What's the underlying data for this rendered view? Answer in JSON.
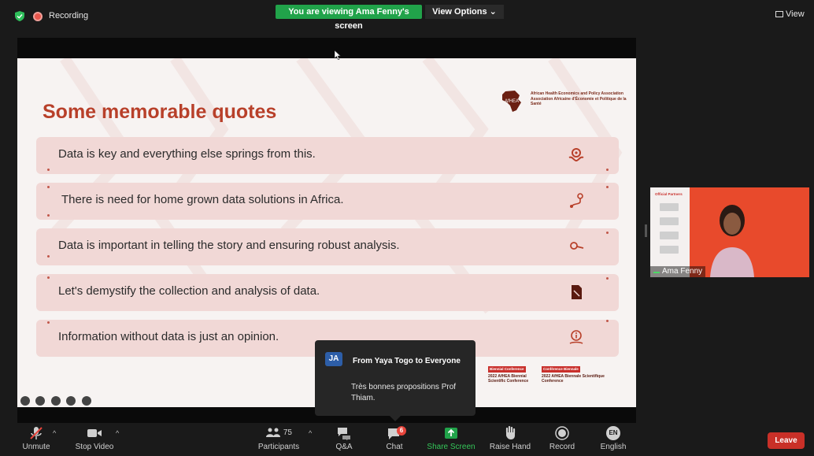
{
  "topbar": {
    "recording_label": "Recording",
    "viewing_banner": "You are viewing Ama Fenny's screen",
    "view_options_label": "View Options ⌄",
    "view_label": "View"
  },
  "slide": {
    "title": "Some memorable quotes",
    "org_name": "African Health Economics and Policy Association Association Africaine d'Économie et Politique de la Santé",
    "logo_text": "AfHEA",
    "quotes": [
      {
        "text": "Data is key and everything else springs from this.",
        "icon": "hand-gear-icon"
      },
      {
        "text": "There is need for home grown data solutions in Africa.",
        "icon": "route-icon"
      },
      {
        "text": "Data is important in telling the story and ensuring robust analysis.",
        "icon": "key-icon"
      },
      {
        "text": "Let's demystify the collection and analysis of data.",
        "icon": "document-icon"
      },
      {
        "text": "Information without data is just an opinion.",
        "icon": "info-hand-icon"
      }
    ],
    "conference_en_tag": "Biennial Conference",
    "conference_en": "2022 AfHEA Biennial Scientific Conference",
    "conference_fr_tag": "Conférence Biennale",
    "conference_fr": "2022 AfHEA Biennale Scientifique Conference"
  },
  "chat_popup": {
    "avatar_initials": "JA",
    "from": "From Yaya Togo to Everyone",
    "message": "Très bonnes propositions Prof Thiam."
  },
  "video_tile": {
    "partner_label": "Official Partners",
    "participant_name": "Ama Fenny"
  },
  "toolbar": {
    "unmute": "Unmute",
    "stop_video": "Stop Video",
    "participants": "Participants",
    "participant_count": "75",
    "qa": "Q&A",
    "chat": "Chat",
    "chat_badge": "6",
    "share_screen": "Share Screen",
    "raise_hand": "Raise Hand",
    "record": "Record",
    "english": "English",
    "english_initials": "EN",
    "leave": "Leave"
  },
  "colors": {
    "accent_green": "#21a34a",
    "slide_title": "#b8402a",
    "quote_band": "#f1d8d6",
    "leave_red": "#c93028"
  }
}
